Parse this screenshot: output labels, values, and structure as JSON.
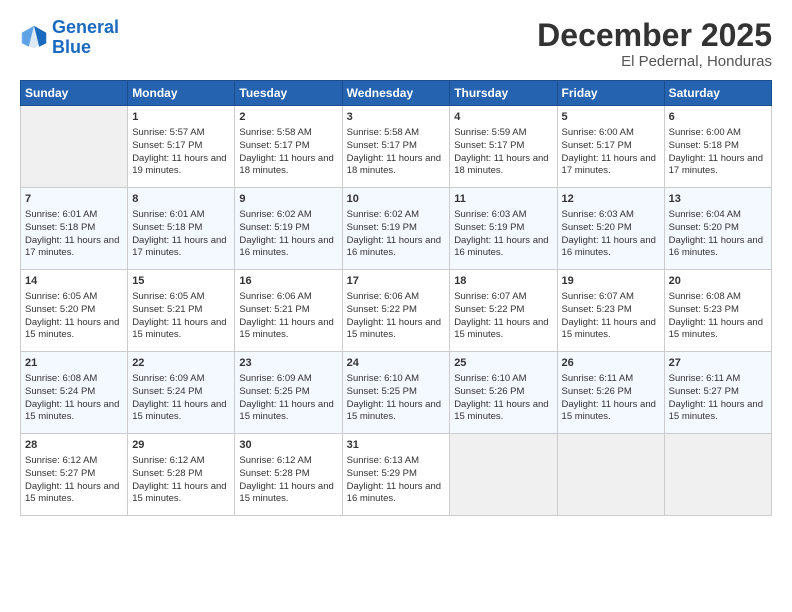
{
  "logo": {
    "line1": "General",
    "line2": "Blue"
  },
  "title": "December 2025",
  "subtitle": "El Pedernal, Honduras",
  "days_of_week": [
    "Sunday",
    "Monday",
    "Tuesday",
    "Wednesday",
    "Thursday",
    "Friday",
    "Saturday"
  ],
  "weeks": [
    [
      {
        "day": "",
        "empty": true
      },
      {
        "day": "1",
        "sunrise": "Sunrise: 5:57 AM",
        "sunset": "Sunset: 5:17 PM",
        "daylight": "Daylight: 11 hours and 19 minutes."
      },
      {
        "day": "2",
        "sunrise": "Sunrise: 5:58 AM",
        "sunset": "Sunset: 5:17 PM",
        "daylight": "Daylight: 11 hours and 18 minutes."
      },
      {
        "day": "3",
        "sunrise": "Sunrise: 5:58 AM",
        "sunset": "Sunset: 5:17 PM",
        "daylight": "Daylight: 11 hours and 18 minutes."
      },
      {
        "day": "4",
        "sunrise": "Sunrise: 5:59 AM",
        "sunset": "Sunset: 5:17 PM",
        "daylight": "Daylight: 11 hours and 18 minutes."
      },
      {
        "day": "5",
        "sunrise": "Sunrise: 6:00 AM",
        "sunset": "Sunset: 5:17 PM",
        "daylight": "Daylight: 11 hours and 17 minutes."
      },
      {
        "day": "6",
        "sunrise": "Sunrise: 6:00 AM",
        "sunset": "Sunset: 5:18 PM",
        "daylight": "Daylight: 11 hours and 17 minutes."
      }
    ],
    [
      {
        "day": "7",
        "sunrise": "Sunrise: 6:01 AM",
        "sunset": "Sunset: 5:18 PM",
        "daylight": "Daylight: 11 hours and 17 minutes."
      },
      {
        "day": "8",
        "sunrise": "Sunrise: 6:01 AM",
        "sunset": "Sunset: 5:18 PM",
        "daylight": "Daylight: 11 hours and 17 minutes."
      },
      {
        "day": "9",
        "sunrise": "Sunrise: 6:02 AM",
        "sunset": "Sunset: 5:19 PM",
        "daylight": "Daylight: 11 hours and 16 minutes."
      },
      {
        "day": "10",
        "sunrise": "Sunrise: 6:02 AM",
        "sunset": "Sunset: 5:19 PM",
        "daylight": "Daylight: 11 hours and 16 minutes."
      },
      {
        "day": "11",
        "sunrise": "Sunrise: 6:03 AM",
        "sunset": "Sunset: 5:19 PM",
        "daylight": "Daylight: 11 hours and 16 minutes."
      },
      {
        "day": "12",
        "sunrise": "Sunrise: 6:03 AM",
        "sunset": "Sunset: 5:20 PM",
        "daylight": "Daylight: 11 hours and 16 minutes."
      },
      {
        "day": "13",
        "sunrise": "Sunrise: 6:04 AM",
        "sunset": "Sunset: 5:20 PM",
        "daylight": "Daylight: 11 hours and 16 minutes."
      }
    ],
    [
      {
        "day": "14",
        "sunrise": "Sunrise: 6:05 AM",
        "sunset": "Sunset: 5:20 PM",
        "daylight": "Daylight: 11 hours and 15 minutes."
      },
      {
        "day": "15",
        "sunrise": "Sunrise: 6:05 AM",
        "sunset": "Sunset: 5:21 PM",
        "daylight": "Daylight: 11 hours and 15 minutes."
      },
      {
        "day": "16",
        "sunrise": "Sunrise: 6:06 AM",
        "sunset": "Sunset: 5:21 PM",
        "daylight": "Daylight: 11 hours and 15 minutes."
      },
      {
        "day": "17",
        "sunrise": "Sunrise: 6:06 AM",
        "sunset": "Sunset: 5:22 PM",
        "daylight": "Daylight: 11 hours and 15 minutes."
      },
      {
        "day": "18",
        "sunrise": "Sunrise: 6:07 AM",
        "sunset": "Sunset: 5:22 PM",
        "daylight": "Daylight: 11 hours and 15 minutes."
      },
      {
        "day": "19",
        "sunrise": "Sunrise: 6:07 AM",
        "sunset": "Sunset: 5:23 PM",
        "daylight": "Daylight: 11 hours and 15 minutes."
      },
      {
        "day": "20",
        "sunrise": "Sunrise: 6:08 AM",
        "sunset": "Sunset: 5:23 PM",
        "daylight": "Daylight: 11 hours and 15 minutes."
      }
    ],
    [
      {
        "day": "21",
        "sunrise": "Sunrise: 6:08 AM",
        "sunset": "Sunset: 5:24 PM",
        "daylight": "Daylight: 11 hours and 15 minutes."
      },
      {
        "day": "22",
        "sunrise": "Sunrise: 6:09 AM",
        "sunset": "Sunset: 5:24 PM",
        "daylight": "Daylight: 11 hours and 15 minutes."
      },
      {
        "day": "23",
        "sunrise": "Sunrise: 6:09 AM",
        "sunset": "Sunset: 5:25 PM",
        "daylight": "Daylight: 11 hours and 15 minutes."
      },
      {
        "day": "24",
        "sunrise": "Sunrise: 6:10 AM",
        "sunset": "Sunset: 5:25 PM",
        "daylight": "Daylight: 11 hours and 15 minutes."
      },
      {
        "day": "25",
        "sunrise": "Sunrise: 6:10 AM",
        "sunset": "Sunset: 5:26 PM",
        "daylight": "Daylight: 11 hours and 15 minutes."
      },
      {
        "day": "26",
        "sunrise": "Sunrise: 6:11 AM",
        "sunset": "Sunset: 5:26 PM",
        "daylight": "Daylight: 11 hours and 15 minutes."
      },
      {
        "day": "27",
        "sunrise": "Sunrise: 6:11 AM",
        "sunset": "Sunset: 5:27 PM",
        "daylight": "Daylight: 11 hours and 15 minutes."
      }
    ],
    [
      {
        "day": "28",
        "sunrise": "Sunrise: 6:12 AM",
        "sunset": "Sunset: 5:27 PM",
        "daylight": "Daylight: 11 hours and 15 minutes."
      },
      {
        "day": "29",
        "sunrise": "Sunrise: 6:12 AM",
        "sunset": "Sunset: 5:28 PM",
        "daylight": "Daylight: 11 hours and 15 minutes."
      },
      {
        "day": "30",
        "sunrise": "Sunrise: 6:12 AM",
        "sunset": "Sunset: 5:28 PM",
        "daylight": "Daylight: 11 hours and 15 minutes."
      },
      {
        "day": "31",
        "sunrise": "Sunrise: 6:13 AM",
        "sunset": "Sunset: 5:29 PM",
        "daylight": "Daylight: 11 hours and 16 minutes."
      },
      {
        "day": "",
        "empty": true
      },
      {
        "day": "",
        "empty": true
      },
      {
        "day": "",
        "empty": true
      }
    ]
  ]
}
